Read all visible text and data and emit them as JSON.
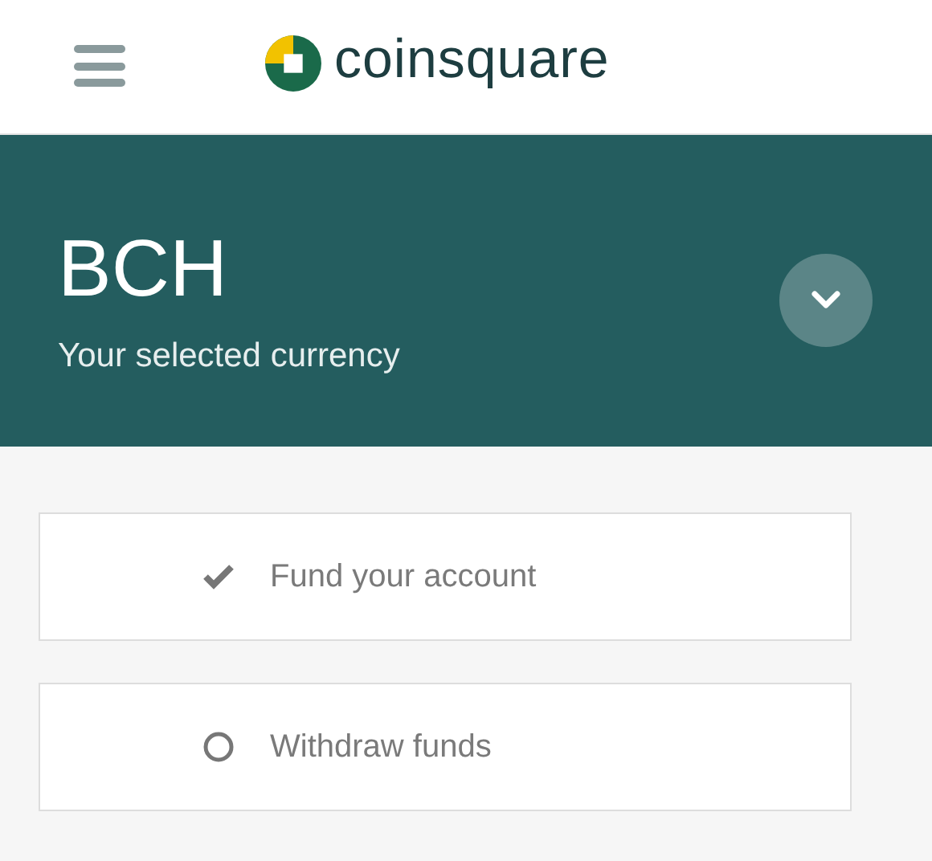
{
  "header": {
    "brand": "coinsquare"
  },
  "currency": {
    "code": "BCH",
    "caption": "Your selected currency"
  },
  "steps": [
    {
      "label": "Fund your account",
      "selected": true
    },
    {
      "label": "Withdraw funds",
      "selected": false
    }
  ]
}
